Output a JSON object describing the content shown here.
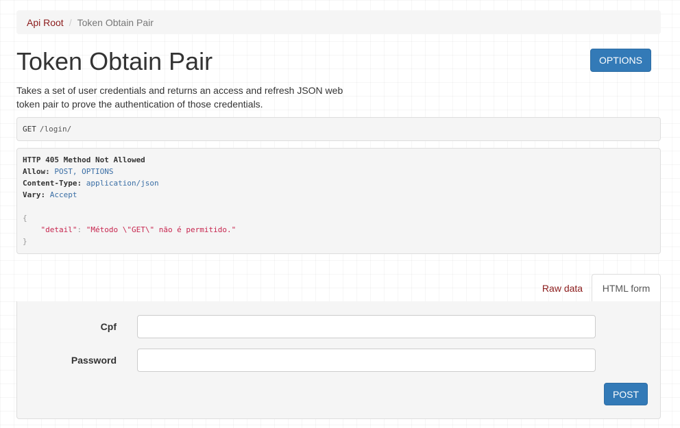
{
  "breadcrumb": {
    "root": "Api Root",
    "separator": "/",
    "current": "Token Obtain Pair"
  },
  "page": {
    "title": "Token Obtain Pair",
    "options_label": "OPTIONS",
    "description": "Takes a set of user credentials and returns an access and refresh JSON web token pair to prove the authentication of those credentials."
  },
  "request": {
    "method": "GET",
    "path": "/login/"
  },
  "response": {
    "status_line": "HTTP 405 Method Not Allowed",
    "headers": [
      {
        "name": "Allow:",
        "value": "POST, OPTIONS"
      },
      {
        "name": "Content-Type:",
        "value": "application/json"
      },
      {
        "name": "Vary:",
        "value": "Accept"
      }
    ],
    "body": {
      "open_brace": "{",
      "key": "\"detail\"",
      "colon": ":",
      "value": "\"Método \\\"GET\\\" não é permitido.\"",
      "close_brace": "}"
    }
  },
  "tabs": {
    "raw": "Raw data",
    "html": "HTML form"
  },
  "form": {
    "cpf_label": "Cpf",
    "cpf_value": "",
    "password_label": "Password",
    "password_value": "",
    "submit_label": "POST"
  },
  "colors": {
    "primary": "#337ab7",
    "link": "#8b1a1a",
    "panel": "#f5f5f5"
  }
}
